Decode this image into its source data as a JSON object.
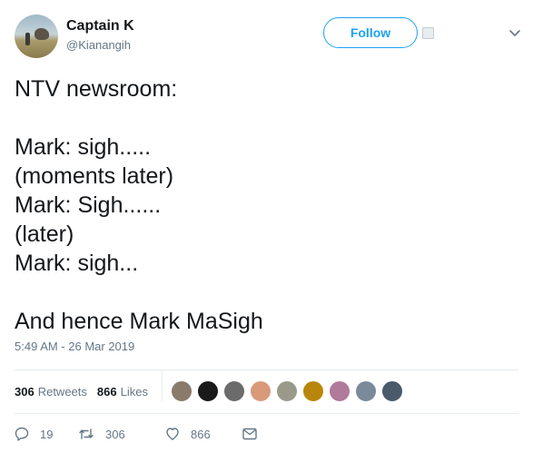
{
  "author": {
    "display_name": "Captain K",
    "handle": "@Kianangih",
    "follow_label": "Follow"
  },
  "tweet": {
    "lines": [
      "NTV newsroom:",
      "",
      "Mark: sigh.....",
      "(moments later)",
      "Mark: Sigh......",
      "(later)",
      "Mark: sigh...",
      "",
      "And hence Mark MaSigh"
    ],
    "timestamp": "5:49 AM - 26 Mar 2019"
  },
  "stats": {
    "retweets_count": "306",
    "retweets_label": "Retweets",
    "likes_count": "866",
    "likes_label": "Likes"
  },
  "likers": [
    {
      "color": "#8a7a6a"
    },
    {
      "color": "#1a1a1a"
    },
    {
      "color": "#6b6b6b"
    },
    {
      "color": "#d99a7a"
    },
    {
      "color": "#9a9a8a"
    },
    {
      "color": "#b8860b"
    },
    {
      "color": "#b07a9a"
    },
    {
      "color": "#7a8a9a"
    },
    {
      "color": "#4a5a6a"
    }
  ],
  "actions": {
    "reply_count": "19",
    "retweet_count": "306",
    "like_count": "866"
  },
  "colors": {
    "accent": "#1da1f2",
    "secondary_text": "#657786",
    "primary_text": "#14171a",
    "divider": "#e6ecf0"
  }
}
